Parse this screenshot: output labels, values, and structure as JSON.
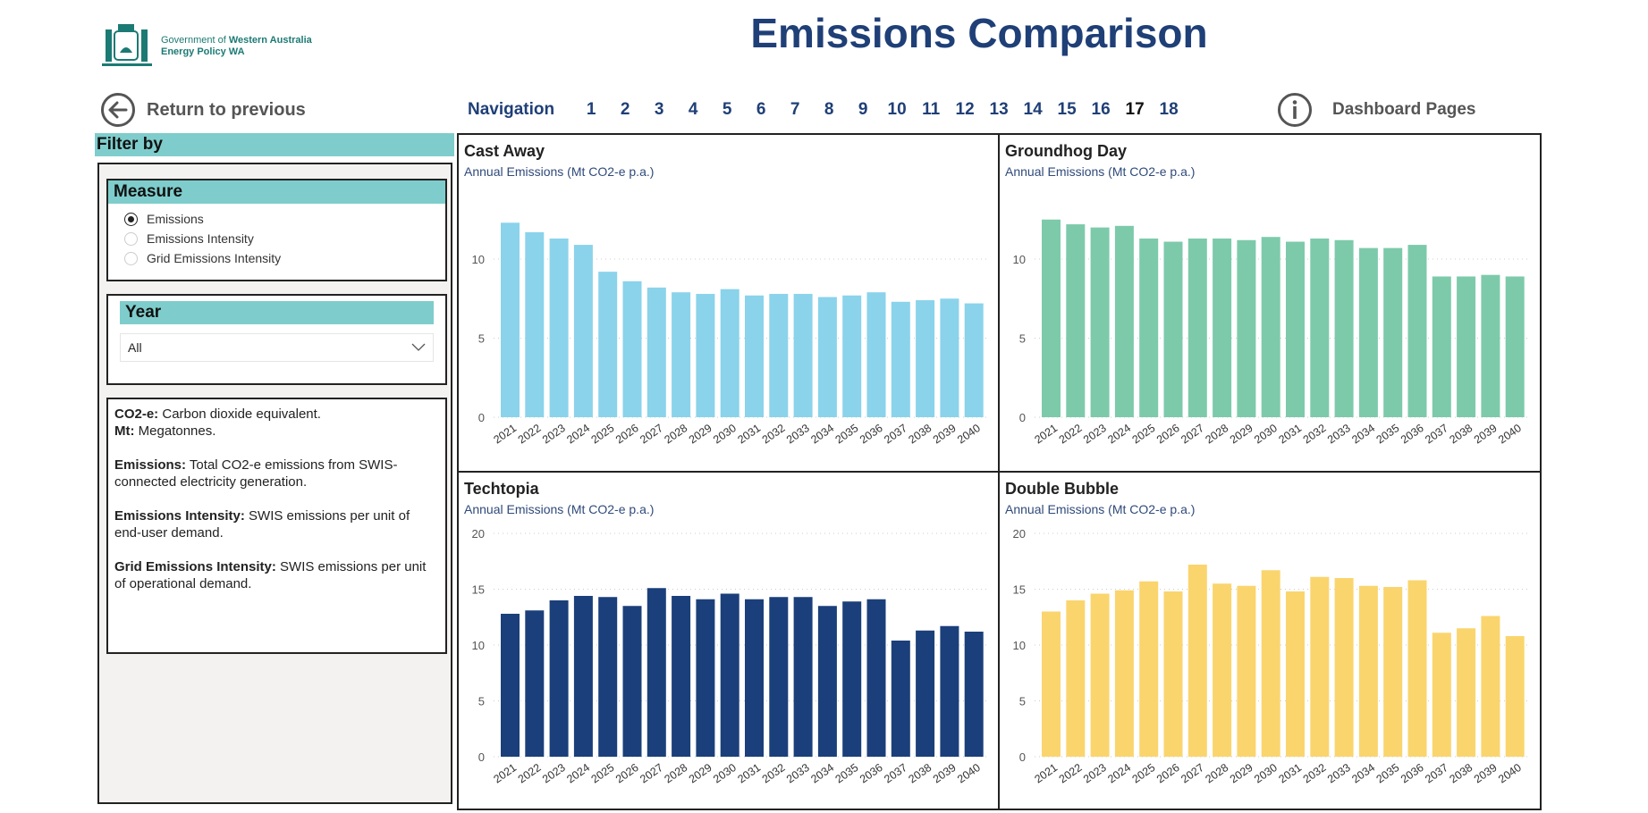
{
  "header": {
    "logo_line1a": "Government of ",
    "logo_line1b": "Western Australia",
    "logo_line2": "Energy Policy WA",
    "title": "Emissions Comparison"
  },
  "back": {
    "label": "Return to previous",
    "icon": "arrow-left-circle-icon"
  },
  "navigation": {
    "label": "Navigation",
    "pages": [
      "1",
      "2",
      "3",
      "4",
      "5",
      "6",
      "7",
      "8",
      "9",
      "10",
      "11",
      "12",
      "13",
      "14",
      "15",
      "16",
      "17",
      "18"
    ],
    "current": "17"
  },
  "dashboard": {
    "label": "Dashboard Pages",
    "icon": "info-circle-icon"
  },
  "filter": {
    "title": "Filter by",
    "measure": {
      "title": "Measure",
      "options": [
        "Emissions",
        "Emissions Intensity",
        "Grid Emissions Intensity"
      ],
      "selected": "Emissions"
    },
    "year": {
      "title": "Year",
      "value": "All"
    },
    "info": [
      [
        {
          "b": "CO2-e:",
          "t": " Carbon dioxide equivalent."
        },
        {
          "b": "Mt:",
          "t": " Megatonnes."
        }
      ],
      [
        {
          "b": "Emissions:",
          "t": " Total CO2-e emissions from SWIS-connected electricity generation."
        }
      ],
      [
        {
          "b": "Emissions Intensity:",
          "t": " SWIS emissions per unit of end-user demand."
        }
      ],
      [
        {
          "b": "Grid Emissions Intensity:",
          "t": " SWIS emissions per unit of operational demand."
        }
      ]
    ]
  },
  "colors": {
    "teal": "#7ECDCC",
    "title_blue": "#1F3F77"
  },
  "chart_data": [
    {
      "type": "bar",
      "title": "Cast Away",
      "subtitle": "Annual Emissions (Mt CO2-e p.a.)",
      "color": "#8AD3EB",
      "yticks": [
        0,
        5,
        10
      ],
      "ylim": [
        0,
        15
      ],
      "grid": true,
      "categories": [
        "2021",
        "2022",
        "2023",
        "2024",
        "2025",
        "2026",
        "2027",
        "2028",
        "2029",
        "2030",
        "2031",
        "2032",
        "2033",
        "2034",
        "2035",
        "2036",
        "2037",
        "2038",
        "2039",
        "2040"
      ],
      "values": [
        12.3,
        11.7,
        11.3,
        10.9,
        9.2,
        8.6,
        8.2,
        7.9,
        7.8,
        8.1,
        7.7,
        7.8,
        7.8,
        7.6,
        7.7,
        7.9,
        7.3,
        7.4,
        7.5,
        7.2
      ]
    },
    {
      "type": "bar",
      "title": "Groundhog Day",
      "subtitle": "Annual Emissions (Mt CO2-e p.a.)",
      "color": "#7DCAAB",
      "yticks": [
        0,
        5,
        10
      ],
      "ylim": [
        0,
        15
      ],
      "grid": true,
      "categories": [
        "2021",
        "2022",
        "2023",
        "2024",
        "2025",
        "2026",
        "2027",
        "2028",
        "2029",
        "2030",
        "2031",
        "2032",
        "2033",
        "2034",
        "2035",
        "2036",
        "2037",
        "2038",
        "2039",
        "2040"
      ],
      "values": [
        12.5,
        12.2,
        12.0,
        12.1,
        11.3,
        11.1,
        11.3,
        11.3,
        11.2,
        11.4,
        11.1,
        11.3,
        11.2,
        10.7,
        10.7,
        10.9,
        8.9,
        8.9,
        9.0,
        8.9
      ]
    },
    {
      "type": "bar",
      "title": "Techtopia",
      "subtitle": "Annual Emissions (Mt CO2-e p.a.)",
      "color": "#1B3F7A",
      "yticks": [
        0,
        5,
        10,
        15,
        20
      ],
      "ylim": [
        0,
        20
      ],
      "grid": true,
      "categories": [
        "2021",
        "2022",
        "2023",
        "2024",
        "2025",
        "2026",
        "2027",
        "2028",
        "2029",
        "2030",
        "2031",
        "2032",
        "2033",
        "2034",
        "2035",
        "2036",
        "2037",
        "2038",
        "2039",
        "2040"
      ],
      "values": [
        12.8,
        13.1,
        14.0,
        14.4,
        14.3,
        13.5,
        15.1,
        14.4,
        14.1,
        14.6,
        14.1,
        14.3,
        14.3,
        13.5,
        13.9,
        14.1,
        10.4,
        11.3,
        11.7,
        11.2
      ]
    },
    {
      "type": "bar",
      "title": "Double Bubble",
      "subtitle": "Annual Emissions (Mt CO2-e p.a.)",
      "color": "#FAD56E",
      "yticks": [
        0,
        5,
        10,
        15,
        20
      ],
      "ylim": [
        0,
        20
      ],
      "grid": true,
      "categories": [
        "2021",
        "2022",
        "2023",
        "2024",
        "2025",
        "2026",
        "2027",
        "2028",
        "2029",
        "2030",
        "2031",
        "2032",
        "2033",
        "2034",
        "2035",
        "2036",
        "2037",
        "2038",
        "2039",
        "2040"
      ],
      "values": [
        13.0,
        14.0,
        14.6,
        14.9,
        15.7,
        14.8,
        17.2,
        15.5,
        15.3,
        16.7,
        14.8,
        16.1,
        16.0,
        15.3,
        15.2,
        15.8,
        11.1,
        11.5,
        12.6,
        10.8
      ]
    }
  ]
}
